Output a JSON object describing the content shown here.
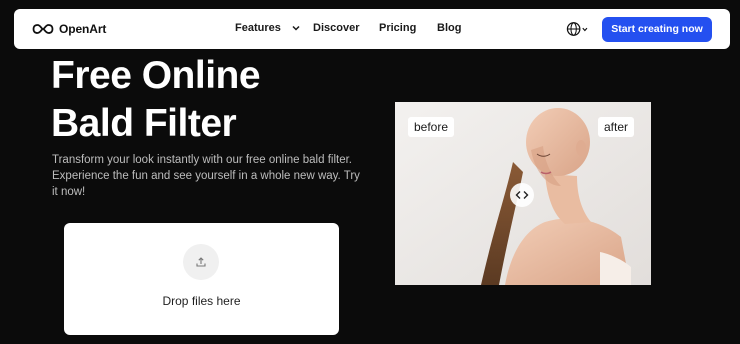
{
  "nav": {
    "brand": "OpenArt",
    "links": [
      {
        "label": "Features"
      },
      {
        "label": "Discover"
      },
      {
        "label": "Pricing"
      },
      {
        "label": "Blog"
      }
    ],
    "cta_label": "Start creating now",
    "icons": {
      "logo": "openart-infinity-logo",
      "globe": "globe-icon",
      "chevron": "chevron-down-icon"
    }
  },
  "hero": {
    "title_line1": "Free Online",
    "title_line2": "Bald Filter",
    "description": "Transform your look instantly with our free online bald filter. Experience the fun and see yourself in a whole new way. Try it now!"
  },
  "upload": {
    "label": "Drop files here",
    "icon": "upload-icon"
  },
  "preview": {
    "before_label": "before",
    "after_label": "after",
    "slider_icon": "compare-arrows-icon"
  },
  "colors": {
    "page_bg": "#0b0b0b",
    "accent": "#2450f0",
    "text_light": "#ffffff",
    "text_muted": "#bdbdbd"
  }
}
